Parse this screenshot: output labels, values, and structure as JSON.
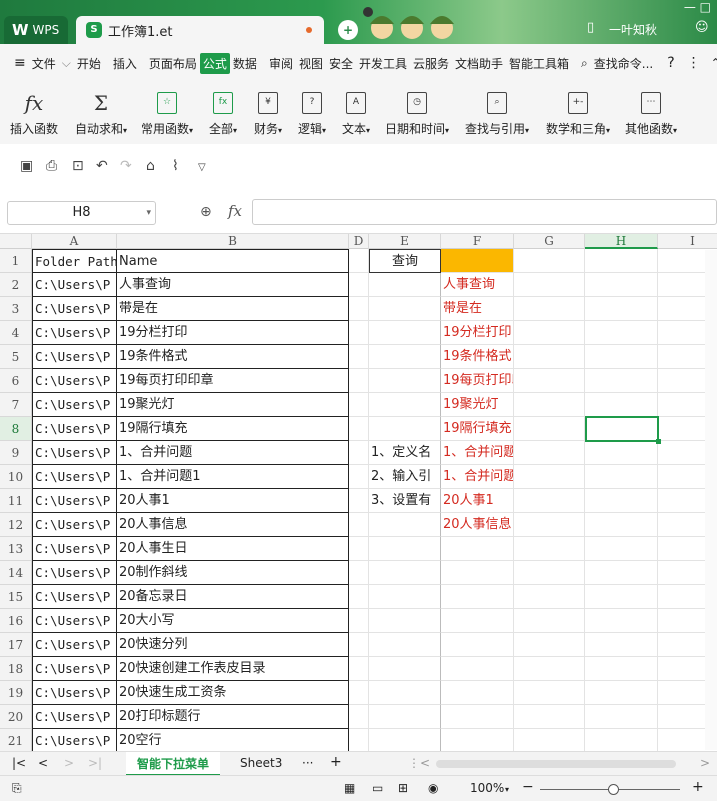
{
  "titlebar": {
    "wps_label": "WPS",
    "doc_title": "工作簿1.et",
    "new_tab": "+",
    "username": "一叶知秋"
  },
  "menubar": {
    "file": "文件",
    "items": [
      "开始",
      "插入",
      "页面布局",
      "公式",
      "数据",
      "审阅",
      "视图",
      "安全",
      "开发工具",
      "云服务",
      "文档助手",
      "智能工具箱"
    ],
    "active": "公式",
    "search": "查找命令..."
  },
  "ribbon": [
    {
      "label": "插入函数",
      "icon": "fx"
    },
    {
      "label": "自动求和",
      "icon": "Σ",
      "dropdown": true
    },
    {
      "label": "常用函数",
      "icon": "☆",
      "dropdown": true
    },
    {
      "label": "全部",
      "icon": "fx",
      "dropdown": true
    },
    {
      "label": "财务",
      "icon": "¥",
      "dropdown": true
    },
    {
      "label": "逻辑",
      "icon": "?",
      "dropdown": true
    },
    {
      "label": "文本",
      "icon": "A",
      "dropdown": true
    },
    {
      "label": "日期和时间",
      "icon": "◷",
      "dropdown": true
    },
    {
      "label": "查找与引用",
      "icon": "⌕",
      "dropdown": true
    },
    {
      "label": "数学和三角",
      "icon": "+-",
      "dropdown": true
    },
    {
      "label": "其他函数",
      "icon": "⋯",
      "dropdown": true
    }
  ],
  "formula_bar": {
    "cell_ref": "H8",
    "fx": "fx",
    "value": ""
  },
  "columns": [
    "A",
    "B",
    "D",
    "E",
    "F",
    "G",
    "H",
    "I"
  ],
  "selected_column": "H",
  "selected_row": "8",
  "rows": [
    {
      "n": "1",
      "A": "Folder Path",
      "B": "Name",
      "E": "查询",
      "F": ""
    },
    {
      "n": "2",
      "A": "C:\\Users\\P",
      "B": "人事查询",
      "E": "",
      "F": "人事查询"
    },
    {
      "n": "3",
      "A": "C:\\Users\\P",
      "B": "带是在",
      "E": "",
      "F": "带是在"
    },
    {
      "n": "4",
      "A": "C:\\Users\\P",
      "B": "19分栏打印",
      "E": "",
      "F": "19分栏打印"
    },
    {
      "n": "5",
      "A": "C:\\Users\\P",
      "B": "19条件格式",
      "E": "",
      "F": "19条件格式"
    },
    {
      "n": "6",
      "A": "C:\\Users\\P",
      "B": "19每页打印印章",
      "E": "",
      "F": "19每页打印印章"
    },
    {
      "n": "7",
      "A": "C:\\Users\\P",
      "B": "19聚光灯",
      "E": "",
      "F": "19聚光灯"
    },
    {
      "n": "8",
      "A": "C:\\Users\\P",
      "B": "19隔行填充",
      "E": "",
      "F": "19隔行填充"
    },
    {
      "n": "9",
      "A": "C:\\Users\\P",
      "B": "1、合并问题",
      "E": "1、定义名",
      "F": "1、合并问题"
    },
    {
      "n": "10",
      "A": "C:\\Users\\P",
      "B": "1、合并问题1",
      "E": "2、输入引",
      "F": "1、合并问题1"
    },
    {
      "n": "11",
      "A": "C:\\Users\\P",
      "B": "20人事1",
      "E": "3、设置有",
      "F": "20人事1"
    },
    {
      "n": "12",
      "A": "C:\\Users\\P",
      "B": "20人事信息",
      "E": "",
      "F": "20人事信息"
    },
    {
      "n": "13",
      "A": "C:\\Users\\P",
      "B": "20人事生日",
      "E": "",
      "F": ""
    },
    {
      "n": "14",
      "A": "C:\\Users\\P",
      "B": "20制作斜线",
      "E": "",
      "F": ""
    },
    {
      "n": "15",
      "A": "C:\\Users\\P",
      "B": "20备忘录日",
      "E": "",
      "F": ""
    },
    {
      "n": "16",
      "A": "C:\\Users\\P",
      "B": "20大小写",
      "E": "",
      "F": ""
    },
    {
      "n": "17",
      "A": "C:\\Users\\P",
      "B": "20快速分列",
      "E": "",
      "F": ""
    },
    {
      "n": "18",
      "A": "C:\\Users\\P",
      "B": "20快速创建工作表皮目录",
      "E": "",
      "F": ""
    },
    {
      "n": "19",
      "A": "C:\\Users\\P",
      "B": "20快速生成工资条",
      "E": "",
      "F": ""
    },
    {
      "n": "20",
      "A": "C:\\Users\\P",
      "B": "20打印标题行",
      "E": "",
      "F": ""
    },
    {
      "n": "21",
      "A": "C:\\Users\\P",
      "B": "20空行",
      "E": "",
      "F": ""
    }
  ],
  "sheets": {
    "active": "智能下拉菜单",
    "other": "Sheet3",
    "more": "···",
    "add": "+"
  },
  "status": {
    "zoom": "100%"
  },
  "colors": {
    "accent": "#1e9b4a",
    "red_text": "#d42a20",
    "highlight": "#fbb700"
  }
}
